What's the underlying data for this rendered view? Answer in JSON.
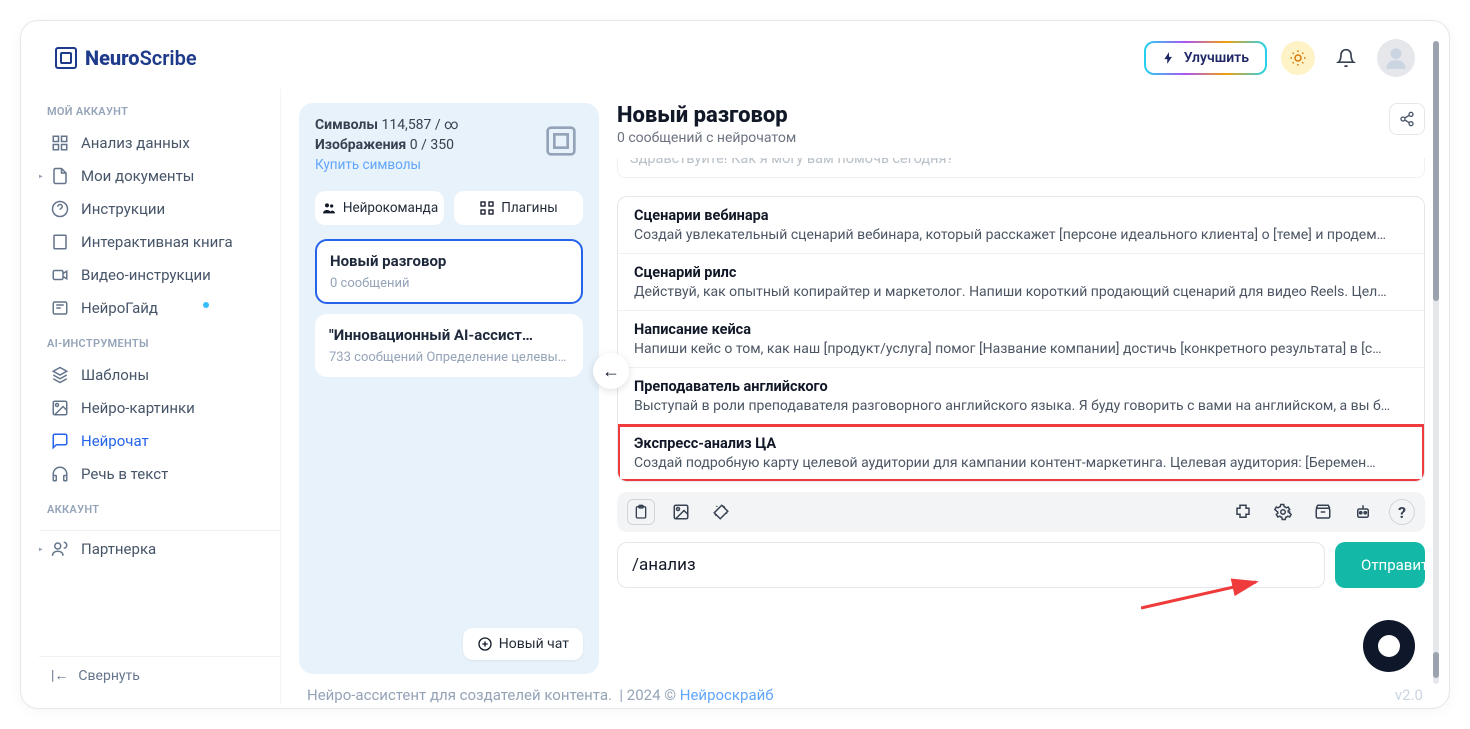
{
  "brand": {
    "name_left": "Neuro",
    "name_right": "Scribe"
  },
  "header": {
    "upgrade": "Улучшить"
  },
  "sidebar": {
    "sections": {
      "account": "МОЙ АККАУНТ",
      "ai": "AI-ИНСТРУМЕНТЫ",
      "acc2": "АККАУНТ"
    },
    "items": {
      "analytics": "Анализ данных",
      "docs": "Мои документы",
      "instructions": "Инструкции",
      "book": "Интерактивная книга",
      "video": "Видео-инструкции",
      "guide": "НейроГайд",
      "templates": "Шаблоны",
      "images": "Нейро-картинки",
      "chat": "Нейрочат",
      "stt": "Речь в текст",
      "affiliate": "Партнерка"
    },
    "collapse": "Свернуть"
  },
  "conv_panel": {
    "symbols_label": "Символы",
    "symbols_value": "114,587 / ∞",
    "images_label": "Изображения",
    "images_value": "0 / 350",
    "buy": "Купить символы",
    "tabs": {
      "team": "Нейрокоманда",
      "plugins": "Плагины"
    },
    "new_chat": "Новый чат",
    "list": [
      {
        "title": "Новый разговор",
        "sub": "0 сообщений"
      },
      {
        "title": "\"Инновационный AI-ассист…",
        "sub": "733 сообщений Определение целевы…"
      }
    ]
  },
  "chat": {
    "title": "Новый разговор",
    "subtitle": "0 сообщений с нейрочатом",
    "greeting_cut": "Здравствуйте! Как я могу вам помочь сегодня?",
    "input_value": "/анализ",
    "send": "Отправить"
  },
  "suggestions": [
    {
      "title": "Сценарии вебинара",
      "desc": "Создай увлекательный сценарий вебинара, который расскажет [персоне идеального клиента] о [теме] и продем…"
    },
    {
      "title": "Сценарий рилс",
      "desc": "Действуй, как опытный копирайтер и маркетолог. Напиши короткий продающий сценарий для видео Reels. Цел…"
    },
    {
      "title": "Написание кейса",
      "desc": "Напиши кейс о том, как наш [продукт/услуга] помог [Название компании] достичь [конкретного результата] в [с…"
    },
    {
      "title": "Преподаватель английского",
      "desc": "Выступай в роли преподавателя разговорного английского языка. Я буду говорить с вами на английском, а вы б…"
    },
    {
      "title": "Экспресс-анализ ЦА",
      "desc": "Создай подробную карту целевой аудитории для кампании контент-маркетинга. Целевая аудитория: [Беремен…"
    }
  ],
  "footer": {
    "text_left": "Нейро-ассистент для создателей контента.",
    "year": "| 2024 ©",
    "link": "Нейроскрайб",
    "version": "v2.0"
  }
}
